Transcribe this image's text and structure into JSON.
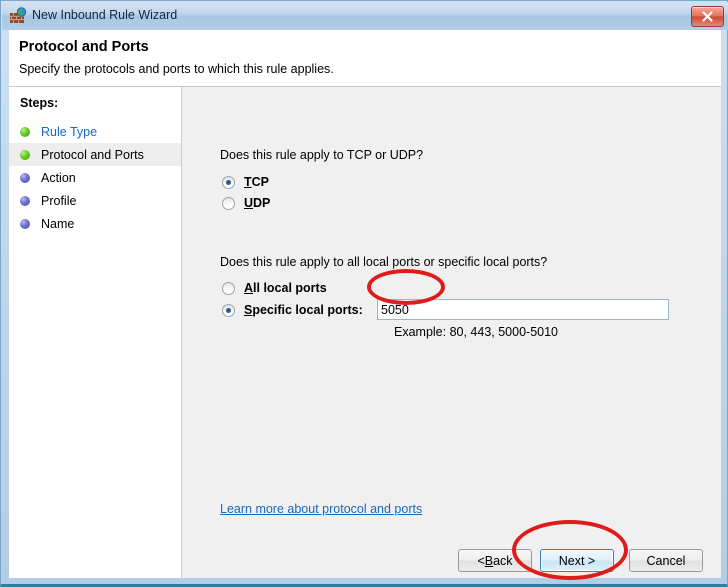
{
  "window": {
    "title": "New Inbound Rule Wizard",
    "icon": "firewall-brick-globe-icon",
    "close_label": "✕"
  },
  "header": {
    "title": "Protocol and Ports",
    "subtitle": "Specify the protocols and ports to which this rule applies."
  },
  "sidebar": {
    "steps_label": "Steps:",
    "items": [
      {
        "label": "Rule Type",
        "state": "done",
        "current": false,
        "link": true
      },
      {
        "label": "Protocol and Ports",
        "state": "done",
        "current": true,
        "link": false
      },
      {
        "label": "Action",
        "state": "todo",
        "current": false,
        "link": false
      },
      {
        "label": "Profile",
        "state": "todo",
        "current": false,
        "link": false
      },
      {
        "label": "Name",
        "state": "todo",
        "current": false,
        "link": false
      }
    ]
  },
  "main": {
    "protocol_question": "Does this rule apply to TCP or UDP?",
    "protocol_options": [
      {
        "label": "TCP",
        "accel": "T",
        "rest": "CP",
        "checked": true
      },
      {
        "label": "UDP",
        "accel": "U",
        "rest": "DP",
        "checked": false
      }
    ],
    "ports_question": "Does this rule apply to all local ports or specific local ports?",
    "ports_options": [
      {
        "label": "All local ports",
        "accel": "A",
        "rest": "ll local ports",
        "checked": false
      },
      {
        "label": "Specific local ports:",
        "accel": "S",
        "rest": "pecific local ports:",
        "checked": true
      }
    ],
    "ports_value": "5050",
    "ports_placeholder": "",
    "ports_example": "Example: 80, 443, 5000-5010",
    "learn_more": "Learn more about protocol and ports"
  },
  "buttons": {
    "back": {
      "pre": "< ",
      "accel": "B",
      "rest": "ack"
    },
    "next": {
      "label": "Next >"
    },
    "cancel": {
      "label": "Cancel"
    }
  },
  "colors": {
    "link": "#1668c4",
    "annotation": "#e01b1b",
    "step_done": "#63cc22",
    "step_todo": "#6c70cf",
    "focus_button": "#3c7fb1"
  }
}
